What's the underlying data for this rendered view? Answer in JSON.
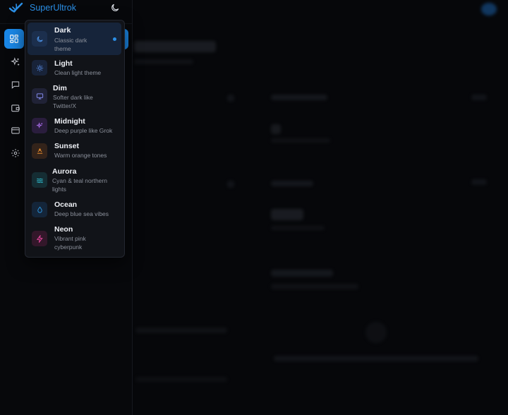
{
  "app": {
    "name": "SuperUltrok"
  },
  "colors": {
    "accent": "#1a87e6",
    "brand_text": "#2b8fe6",
    "selected_bg": "#16243a"
  },
  "sidebar": {
    "items": [
      {
        "icon": "dashboard-icon",
        "active": true
      },
      {
        "icon": "sparkles-icon",
        "active": false
      },
      {
        "icon": "chat-icon",
        "active": false
      },
      {
        "icon": "wallet-icon",
        "active": false
      },
      {
        "icon": "credit-card-icon",
        "active": false
      },
      {
        "icon": "gear-icon",
        "active": false
      }
    ]
  },
  "theme_menu": {
    "selected": "Dark",
    "options": [
      {
        "title": "Dark",
        "desc": "Classic dark theme",
        "icon": "moon-icon",
        "color": "#4b8fe0"
      },
      {
        "title": "Light",
        "desc": "Clean light theme",
        "icon": "sun-icon",
        "color": "#5a8ee8"
      },
      {
        "title": "Dim",
        "desc": "Softer dark like Twitter/X",
        "icon": "monitor-icon",
        "color": "#7f86e6"
      },
      {
        "title": "Midnight",
        "desc": "Deep purple like Grok",
        "icon": "sparkle-icon",
        "color": "#a76ce8"
      },
      {
        "title": "Sunset",
        "desc": "Warm orange tones",
        "icon": "sunset-icon",
        "color": "#e58a2c"
      },
      {
        "title": "Aurora",
        "desc": "Cyan & teal northern lights",
        "icon": "waves-icon",
        "color": "#2fb7c9"
      },
      {
        "title": "Ocean",
        "desc": "Deep blue sea vibes",
        "icon": "droplet-icon",
        "color": "#2a8fd6"
      },
      {
        "title": "Neon",
        "desc": "Vibrant pink cyberpunk",
        "icon": "zap-icon",
        "color": "#e0459a"
      }
    ]
  }
}
